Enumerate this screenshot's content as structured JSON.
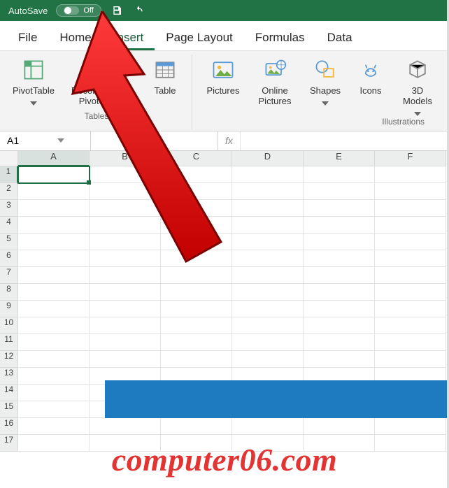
{
  "app_title": "AutoSave",
  "autosave": {
    "label": "Off"
  },
  "menu": {
    "tabs": [
      "File",
      "Home",
      "Insert",
      "Page Layout",
      "Formulas",
      "Data"
    ],
    "active_index": 2
  },
  "ribbon": {
    "groups": [
      {
        "label": "Tables",
        "buttons": [
          {
            "name": "pivottable",
            "label": "PivotTable",
            "dropdown": true
          },
          {
            "name": "recommended-pivottables",
            "label": "Recommended PivotTables",
            "dropdown": false
          },
          {
            "name": "table",
            "label": "Table",
            "dropdown": false
          }
        ]
      },
      {
        "label": "Illustrations",
        "buttons": [
          {
            "name": "pictures",
            "label": "Pictures",
            "dropdown": false
          },
          {
            "name": "online-pictures",
            "label": "Online Pictures",
            "dropdown": false
          },
          {
            "name": "shapes",
            "label": "Shapes",
            "dropdown": true
          },
          {
            "name": "icons",
            "label": "Icons",
            "dropdown": false
          },
          {
            "name": "3d-models",
            "label": "3D Models",
            "dropdown": true
          }
        ]
      }
    ]
  },
  "formula_bar": {
    "namebox_value": "A1",
    "fx_label": "fx",
    "formula_value": ""
  },
  "grid": {
    "columns": [
      "A",
      "B",
      "C",
      "D",
      "E",
      "F"
    ],
    "row_count": 17,
    "active_cell": {
      "col": "A",
      "row": 1
    }
  },
  "watermark": "computer06.com"
}
